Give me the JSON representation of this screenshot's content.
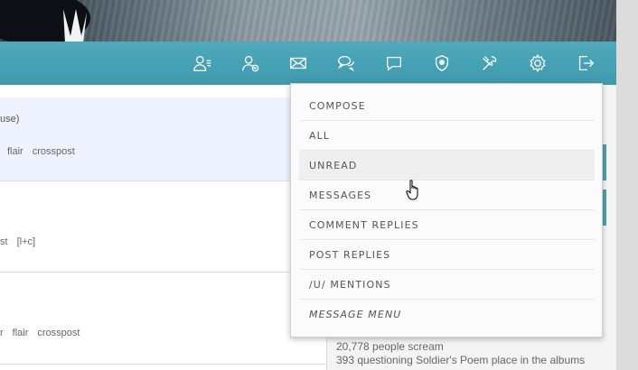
{
  "nav": {
    "icons": [
      "profile-icon",
      "friends-icon",
      "mail-icon",
      "chat-bubbles-icon",
      "comment-icon",
      "shield-icon",
      "tools-icon",
      "gear-icon",
      "logout-icon"
    ]
  },
  "posts": [
    {
      "line1": "use)",
      "actions": [
        "flair",
        "crosspost"
      ]
    },
    {
      "line1": "",
      "actions": [
        "st",
        "[l+c]"
      ]
    },
    {
      "line1": "",
      "actions": [
        "r",
        "flair",
        "crosspost"
      ]
    }
  ],
  "sidebar": {
    "stat1": "20,778 people scream",
    "stat2": "393 questioning Soldier's Poem place in the albums"
  },
  "menu": {
    "items": [
      "COMPOSE",
      "ALL",
      "UNREAD",
      "MESSAGES",
      "COMMENT REPLIES",
      "POST REPLIES",
      "/U/ MENTIONS"
    ],
    "active_index": 2,
    "footer": "MESSAGE MENU"
  },
  "colors": {
    "navbar": "#3f9aae",
    "accent": "#4aa3b5",
    "menu_bg": "#fbfbfb",
    "menu_active": "#efefef"
  }
}
